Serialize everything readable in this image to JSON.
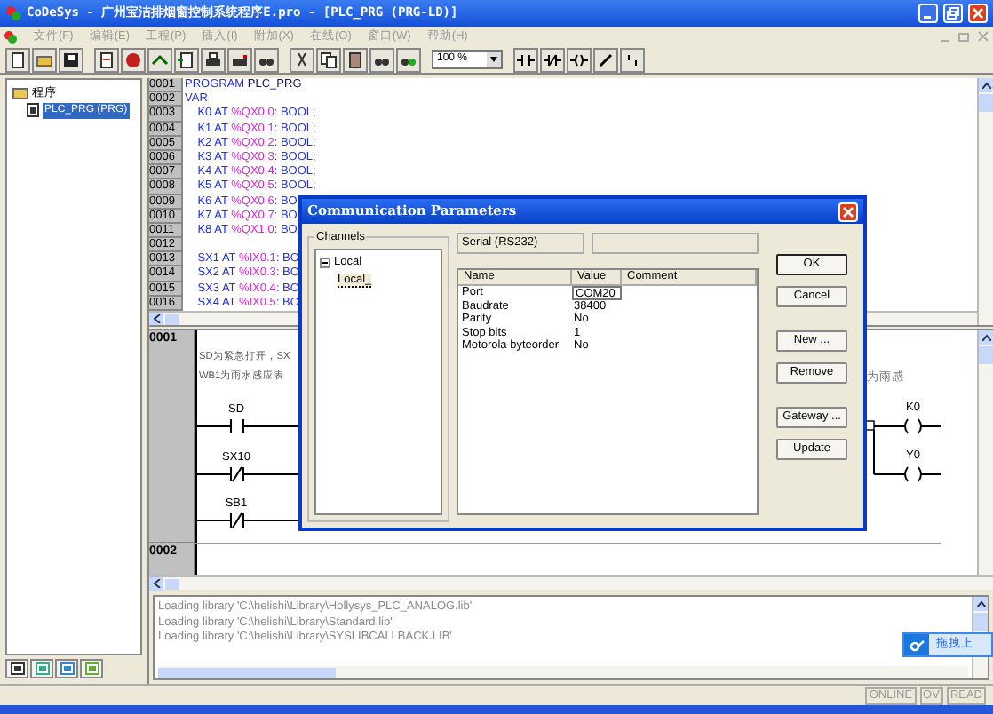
{
  "window": {
    "title": "CoDeSys - 广州宝洁排烟窗控制系统程序E.pro - [PLC_PRG (PRG-LD)]"
  },
  "menu": [
    "文件(F)",
    "编辑(E)",
    "工程(P)",
    "插入(I)",
    "附加(X)",
    "在线(O)",
    "窗口(W)",
    "帮助(H)"
  ],
  "toolbar": {
    "zoom": "100 %"
  },
  "project_tree": {
    "root": "程序",
    "children": [
      {
        "label": "PLC_PRG (PRG)",
        "selected": true
      }
    ]
  },
  "declaration": {
    "lines": [
      {
        "number": "0001",
        "parts": [
          {
            "kind": "keyword",
            "text": "PROGRAM"
          },
          {
            "kind": "plain",
            "text": " PLC_PRG"
          }
        ]
      },
      {
        "number": "0002",
        "parts": [
          {
            "kind": "keyword",
            "text": "VAR"
          }
        ]
      },
      {
        "number": "0003",
        "parts": [
          {
            "kind": "keyword",
            "text": "    K0 AT "
          },
          {
            "kind": "address",
            "text": "%QX0.0"
          },
          {
            "kind": "keyword",
            "text": ": BOOL;"
          }
        ]
      },
      {
        "number": "0004",
        "parts": [
          {
            "kind": "keyword",
            "text": "    K1 AT "
          },
          {
            "kind": "address",
            "text": "%QX0.1"
          },
          {
            "kind": "keyword",
            "text": ": BOOL;"
          }
        ]
      },
      {
        "number": "0005",
        "parts": [
          {
            "kind": "keyword",
            "text": "    K2 AT "
          },
          {
            "kind": "address",
            "text": "%QX0.2"
          },
          {
            "kind": "keyword",
            "text": ": BOOL;"
          }
        ]
      },
      {
        "number": "0006",
        "parts": [
          {
            "kind": "keyword",
            "text": "    K3 AT "
          },
          {
            "kind": "address",
            "text": "%QX0.3"
          },
          {
            "kind": "keyword",
            "text": ": BOOL;"
          }
        ]
      },
      {
        "number": "0007",
        "parts": [
          {
            "kind": "keyword",
            "text": "    K4 AT "
          },
          {
            "kind": "address",
            "text": "%QX0.4"
          },
          {
            "kind": "keyword",
            "text": ": BOOL;"
          }
        ]
      },
      {
        "number": "0008",
        "parts": [
          {
            "kind": "keyword",
            "text": "    K5 AT "
          },
          {
            "kind": "address",
            "text": "%QX0.5"
          },
          {
            "kind": "keyword",
            "text": ": BOOL;"
          }
        ]
      },
      {
        "number": "0009",
        "parts": [
          {
            "kind": "keyword",
            "text": "    K6 AT "
          },
          {
            "kind": "address",
            "text": "%QX0.6"
          },
          {
            "kind": "keyword",
            "text": ": BO"
          }
        ]
      },
      {
        "number": "0010",
        "parts": [
          {
            "kind": "keyword",
            "text": "    K7 AT "
          },
          {
            "kind": "address",
            "text": "%QX0.7"
          },
          {
            "kind": "keyword",
            "text": ": BO"
          }
        ]
      },
      {
        "number": "0011",
        "parts": [
          {
            "kind": "keyword",
            "text": "    K8 AT "
          },
          {
            "kind": "address",
            "text": "%QX1.0"
          },
          {
            "kind": "keyword",
            "text": ": BO"
          }
        ]
      },
      {
        "number": "0012"
      },
      {
        "number": "0013",
        "parts": [
          {
            "kind": "keyword",
            "text": "    SX1 AT "
          },
          {
            "kind": "address",
            "text": "%IX0.1"
          },
          {
            "kind": "keyword",
            "text": ": BO"
          }
        ]
      },
      {
        "number": "0014",
        "parts": [
          {
            "kind": "keyword",
            "text": "    SX2 AT "
          },
          {
            "kind": "address",
            "text": "%IX0.3"
          },
          {
            "kind": "keyword",
            "text": ": BO"
          }
        ]
      },
      {
        "number": "0015",
        "parts": [
          {
            "kind": "keyword",
            "text": "    SX3 AT "
          },
          {
            "kind": "address",
            "text": "%IX0.4"
          },
          {
            "kind": "keyword",
            "text": ": BO"
          }
        ]
      },
      {
        "number": "0016",
        "parts": [
          {
            "kind": "keyword",
            "text": "    SX4 AT "
          },
          {
            "kind": "address",
            "text": "%IX0.5"
          },
          {
            "kind": "keyword",
            "text": ": BO"
          }
        ]
      }
    ]
  },
  "ladder": {
    "networks": [
      "0001",
      "0002"
    ],
    "comment_lines": [
      "SD为紧急打开，SX",
      "WB1为雨水感应表"
    ],
    "comment_tail": "为雨感",
    "contacts": [
      {
        "label": "SD",
        "kind": "open"
      },
      {
        "label": "SX10",
        "kind": "closed"
      },
      {
        "label": "SB1",
        "kind": "closed"
      }
    ],
    "coils": [
      {
        "label": "K0"
      },
      {
        "label": "Y0"
      }
    ]
  },
  "messages": [
    "Loading library 'C:\\helishi\\Library\\Hollysys_PLC_ANALOG.lib'",
    "Loading library 'C:\\helishi\\Library\\Standard.lib'",
    "Loading library 'C:\\helishi\\Library\\SYSLIBCALLBACK.LIB'"
  ],
  "upload_widget": {
    "label": "拖拽上"
  },
  "status_bar": [
    {
      "label": "ONLINE"
    },
    {
      "label": "OV"
    },
    {
      "label": "READ"
    }
  ],
  "dialog": {
    "title": "Communication Parameters",
    "channels_label": "Channels",
    "channels": [
      {
        "label": "Local",
        "expanded": true,
        "children": [
          {
            "label": "Local_",
            "selected": true
          }
        ]
      }
    ],
    "driver": "Serial (RS232)",
    "columns": [
      "Name",
      "Value",
      "Comment"
    ],
    "parameters": [
      {
        "name": "Port",
        "value": "COM20",
        "selected": true
      },
      {
        "name": "Baudrate",
        "value": "38400",
        "selected": false
      },
      {
        "name": "Parity",
        "value": "No",
        "selected": false
      },
      {
        "name": "Stop bits",
        "value": "1",
        "selected": false
      },
      {
        "name": "Motorola byteorder",
        "value": "No",
        "selected": false
      }
    ],
    "buttons": [
      {
        "label": "OK",
        "default": true
      },
      {
        "label": "Cancel",
        "default": false
      },
      {
        "label": "New ...",
        "default": false
      },
      {
        "label": "Remove",
        "default": false
      },
      {
        "label": "Gateway ...",
        "default": false
      },
      {
        "label": "Update",
        "default": false
      }
    ]
  }
}
